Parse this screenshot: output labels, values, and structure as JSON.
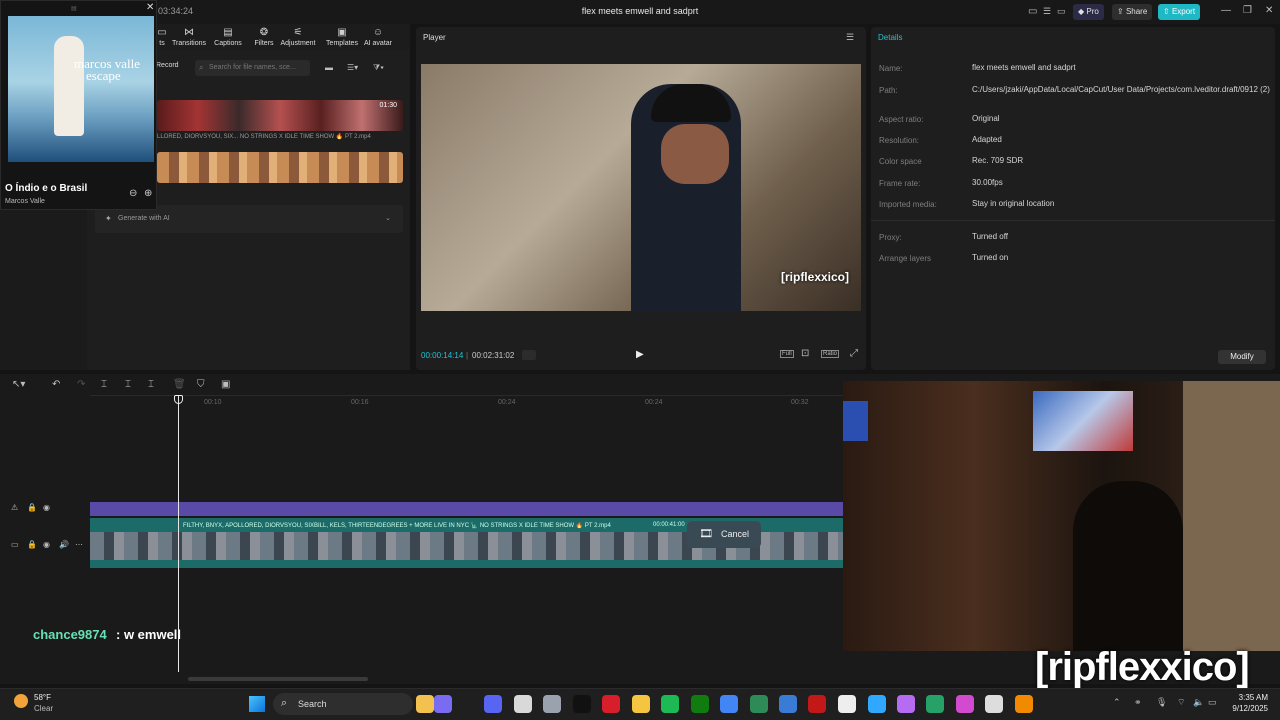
{
  "window": {
    "title": "flex meets emwell and sadprt",
    "clock": "03:34:24",
    "pro_label": "Pro",
    "share_label": "Share",
    "export_label": "Export",
    "minimize": "—",
    "maximize": "❐",
    "close": "✕"
  },
  "toolbar": {
    "items": [
      {
        "label": "ts",
        "icon": "▭"
      },
      {
        "label": "Transitions",
        "icon": "⋈"
      },
      {
        "label": "Captions",
        "icon": "▤"
      },
      {
        "label": "Filters",
        "icon": "❂"
      },
      {
        "label": "Adjustment",
        "icon": "⚟"
      },
      {
        "label": "Templates",
        "icon": "▣"
      },
      {
        "label": "AI avatar",
        "icon": "☺"
      }
    ]
  },
  "media": {
    "record_label": "Record",
    "search_placeholder": "Search for file names, sce...",
    "clip1_duration": "01:30",
    "clip1_title": "LLORED, DIORVSYOU, SIX... NO STRINGS X IDLE TIME SHOW 🔥 PT 2.mp4",
    "generate_ai": "Generate with AI"
  },
  "now_playing": {
    "album_artist_art": "marcos valle",
    "album_title_art": "escape",
    "track": "O Índio e o Brasil",
    "artist": "Marcos Valle",
    "close": "✕"
  },
  "player": {
    "header": "Player",
    "caption": "[ripflexxico]",
    "current_time": "00:00:14:14",
    "total_time": "00:02:31:02",
    "play_icon": "▶",
    "full_label": "Full",
    "ratio_label": "Ratio"
  },
  "details": {
    "header": "Details",
    "rows": [
      {
        "key": "Name:",
        "value": "flex meets emwell and sadprt"
      },
      {
        "key": "Path:",
        "value": "C:/Users/jzaki/AppData/Local/CapCut/User Data/Projects/com.lveditor.draft/0912 (2)"
      },
      {
        "key": "Aspect ratio:",
        "value": "Original"
      },
      {
        "key": "Resolution:",
        "value": "Adapted"
      },
      {
        "key": "Color space",
        "value": "Rec. 709 SDR"
      },
      {
        "key": "Frame rate:",
        "value": "30.00fps"
      },
      {
        "key": "Imported media:",
        "value": "Stay in original location"
      },
      {
        "key": "Proxy:",
        "value": "Turned off"
      },
      {
        "key": "Arrange layers",
        "value": "Turned on"
      }
    ],
    "modify_label": "Modify"
  },
  "timeline": {
    "ticks": [
      "00:10",
      "00:16",
      "00:24",
      "00:24",
      "00:32"
    ],
    "track_title": "FILTHY, BNYX, APOLLORED, DIORVSYOU, SIXBILL, KELS, THIRTEENDEGREES + MORE LIVE IN NYC 🗽 NO STRINGS X IDLE TIME SHOW 🔥 PT 2.mp4",
    "track_duration": "00:00:41:00",
    "cancel_label": "Cancel",
    "chat_user": "chance9874",
    "chat_message": ": w emwell",
    "overlay_caption": "[ripflexxico]"
  },
  "taskbar": {
    "weather_temp": "58°F",
    "weather_cond": "Clear",
    "search_label": "Search",
    "time": "3:35 AM",
    "date": "9/12/2025"
  },
  "colors": {
    "accent": "#21c3cf",
    "export": "#1fb8c4",
    "purple_track": "#5a4aa8",
    "chat_user": "#66e0b4"
  }
}
